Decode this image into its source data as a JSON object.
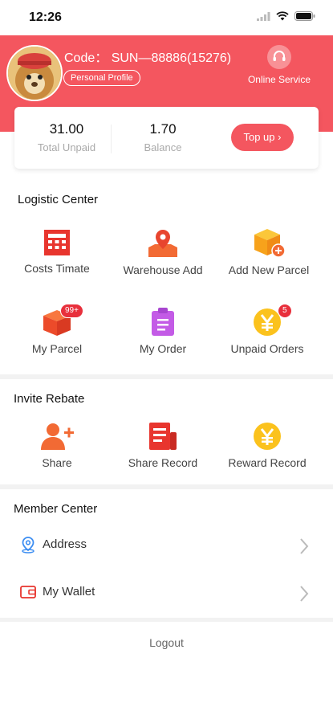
{
  "status_bar": {
    "time": "12:26"
  },
  "header": {
    "code": "Code： SUN—88886(15276)",
    "profile_label": "Personal Profile",
    "online_service_label": "Online Service",
    "bg_color": "#f4565f"
  },
  "balance_card": {
    "total_unpaid_value": "31.00",
    "total_unpaid_label": "Total Unpaid",
    "balance_value": "1.70",
    "balance_label": "Balance",
    "topup_label": "Top up"
  },
  "logistic_center": {
    "title": "Logistic Center",
    "items": [
      {
        "label": "Costs Timate",
        "icon": "calculator-icon"
      },
      {
        "label": "Warehouse Add",
        "icon": "location-pin-icon"
      },
      {
        "label": "Add New Parcel",
        "icon": "box-plus-icon"
      },
      {
        "label": "My Parcel",
        "icon": "parcel-icon",
        "badge": "99+"
      },
      {
        "label": "My Order",
        "icon": "clipboard-icon"
      },
      {
        "label": "Unpaid Orders",
        "icon": "yen-coin-icon",
        "badge": "5"
      }
    ]
  },
  "invite_rebate": {
    "title": "Invite Rebate",
    "items": [
      {
        "label": "Share",
        "icon": "add-user-icon"
      },
      {
        "label": "Share Record",
        "icon": "record-icon"
      },
      {
        "label": "Reward Record",
        "icon": "yen-coin-icon"
      }
    ]
  },
  "member_center": {
    "title": "Member Center",
    "items": [
      {
        "label": "Address",
        "icon": "location-icon"
      },
      {
        "label": "My Wallet",
        "icon": "wallet-icon"
      }
    ]
  },
  "logout_label": "Logout"
}
